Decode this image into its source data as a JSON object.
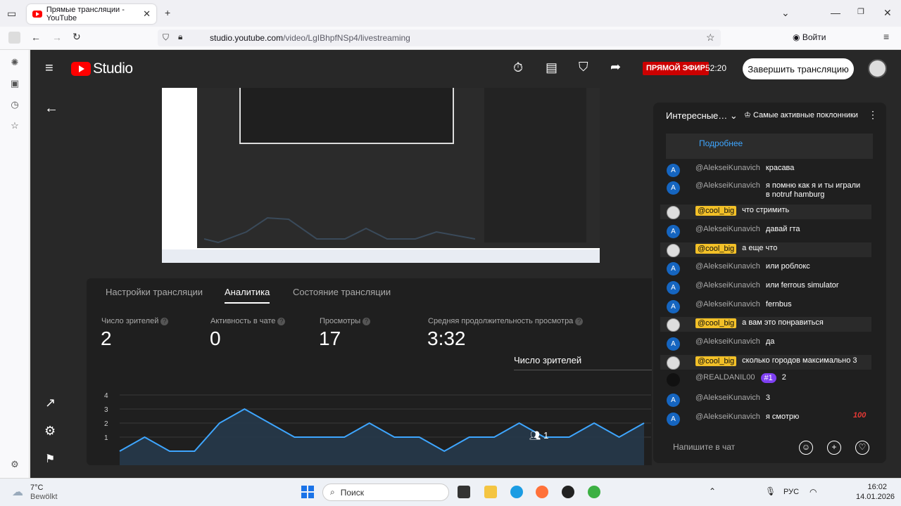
{
  "browser": {
    "tab_title": "Прямые трансляции - YouTube",
    "url_host": "studio.youtube.com",
    "url_path": "/video/LgIBhpfNSp4/livestreaming",
    "sign_in_label": "Войти"
  },
  "studio": {
    "logo_text": "Studio",
    "live_badge": "ПРЯМОЙ ЭФИР",
    "timer": "52:20",
    "end_stream_label": "Завершить трансляцию"
  },
  "analytics": {
    "tabs": [
      "Настройки трансляции",
      "Аналитика",
      "Состояние трансляции"
    ],
    "stats": [
      {
        "label": "Число зрителей",
        "value": "2"
      },
      {
        "label": "Активность в чате",
        "value": "0"
      },
      {
        "label": "Просмотры",
        "value": "17"
      },
      {
        "label": "Средняя продолжительность просмотра",
        "value": "3:32"
      }
    ],
    "metric_dropdown": "Число зрителей",
    "viewers_badge": "1"
  },
  "chart_data": {
    "type": "area",
    "yticks": [
      "1",
      "2",
      "3",
      "4"
    ],
    "ylim": [
      0,
      4
    ],
    "values": [
      0,
      1,
      0,
      0,
      2,
      3,
      2,
      1,
      1,
      1,
      2,
      1,
      1,
      0,
      1,
      1,
      2,
      1,
      1,
      2,
      1,
      2
    ],
    "color": "#3ea6ff"
  },
  "chat": {
    "title": "Интересные…",
    "filter": "Самые активные поклонники",
    "more_link": "Подробнее",
    "messages": [
      {
        "author": "@AlekseiKunavich",
        "text": "красава",
        "avatar": "A",
        "tagged": false
      },
      {
        "author": "@AlekseiKunavich",
        "text": "я помню как я и ты играли в notruf hamburg",
        "avatar": "A",
        "tagged": false
      },
      {
        "author": "@cool_big",
        "text": "что стримить",
        "avatar": "img",
        "tagged": true
      },
      {
        "author": "@AlekseiKunavich",
        "text": "давай гта",
        "avatar": "A",
        "tagged": false
      },
      {
        "author": "@cool_big",
        "text": "а еще что",
        "avatar": "img",
        "tagged": true
      },
      {
        "author": "@AlekseiKunavich",
        "text": "или роблокс",
        "avatar": "A",
        "tagged": false
      },
      {
        "author": "@AlekseiKunavich",
        "text": "или ferrous simulator",
        "avatar": "A",
        "tagged": false
      },
      {
        "author": "@AlekseiKunavich",
        "text": "fernbus",
        "avatar": "A",
        "tagged": false
      },
      {
        "author": "@cool_big",
        "text": "а вам это понравиться",
        "avatar": "img",
        "tagged": true
      },
      {
        "author": "@AlekseiKunavich",
        "text": "да",
        "avatar": "A",
        "tagged": false
      },
      {
        "author": "@cool_big",
        "text": "сколько городов максимально 3",
        "avatar": "img",
        "tagged": true
      },
      {
        "author": "@REALDANIL00",
        "text": "2",
        "avatar": "dark",
        "tagged": false,
        "badge": "#1"
      },
      {
        "author": "@AlekseiKunavich",
        "text": "3",
        "avatar": "A",
        "tagged": false
      },
      {
        "author": "@AlekseiKunavich",
        "text": "я смотрю",
        "avatar": "A",
        "tagged": false
      }
    ],
    "input_placeholder": "Напишите в чат"
  },
  "taskbar": {
    "weather_temp": "7°C",
    "weather_desc": "Bewölkt",
    "search_label": "Поиск",
    "lang": "РУС",
    "time": "16:02",
    "date": "14.01.2026"
  }
}
